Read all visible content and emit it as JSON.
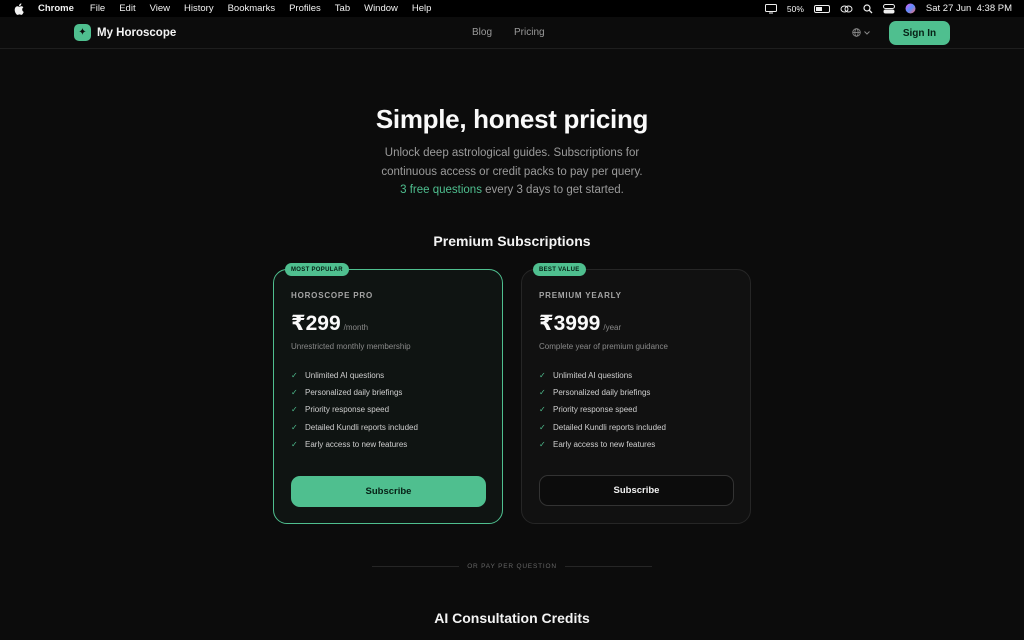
{
  "menubar": {
    "app": "Chrome",
    "items": [
      "File",
      "Edit",
      "View",
      "History",
      "Bookmarks",
      "Profiles",
      "Tab",
      "Window",
      "Help"
    ],
    "battery": "50%",
    "battery_level": 0.5,
    "datetime": "Sat 27 Jun  4:38 PM",
    "icons": [
      "apple-icon",
      "display-icon",
      "battery-icon",
      "link-icon",
      "search-icon",
      "control-center-icon",
      "siri-icon"
    ]
  },
  "header": {
    "brand": "My Horoscope",
    "nav": [
      "Blog",
      "Pricing"
    ],
    "language_icon": "globe-icon",
    "signin": "Sign In"
  },
  "hero": {
    "title": "Simple, honest pricing",
    "subtitle_line1": "Unlock deep astrological guides. Subscriptions for",
    "subtitle_line2": "continuous access or credit packs to pay per query.",
    "free_highlight": "3 free questions",
    "free_rest": " every 3 days to get started."
  },
  "subscriptions": {
    "title": "Premium Subscriptions",
    "plans": [
      {
        "badge": "MOST POPULAR",
        "name": "HOROSCOPE PRO",
        "price": "₹299",
        "period": "/month",
        "description": "Unrestricted monthly membership",
        "features": [
          "Unlimited AI questions",
          "Personalized daily briefings",
          "Priority response speed",
          "Detailed Kundli reports included",
          "Early access to new features"
        ],
        "cta": "Subscribe"
      },
      {
        "badge": "BEST VALUE",
        "name": "PREMIUM YEARLY",
        "price": "₹3999",
        "period": "/year",
        "description": "Complete year of premium guidance",
        "features": [
          "Unlimited AI questions",
          "Personalized daily briefings",
          "Priority response speed",
          "Detailed Kundli reports included",
          "Early access to new features"
        ],
        "cta": "Subscribe"
      }
    ]
  },
  "divider": "OR PAY PER QUESTION",
  "credits": {
    "title": "AI Consultation Credits"
  },
  "colors": {
    "accent": "#4fbf8f",
    "background": "#0c0c0c"
  }
}
